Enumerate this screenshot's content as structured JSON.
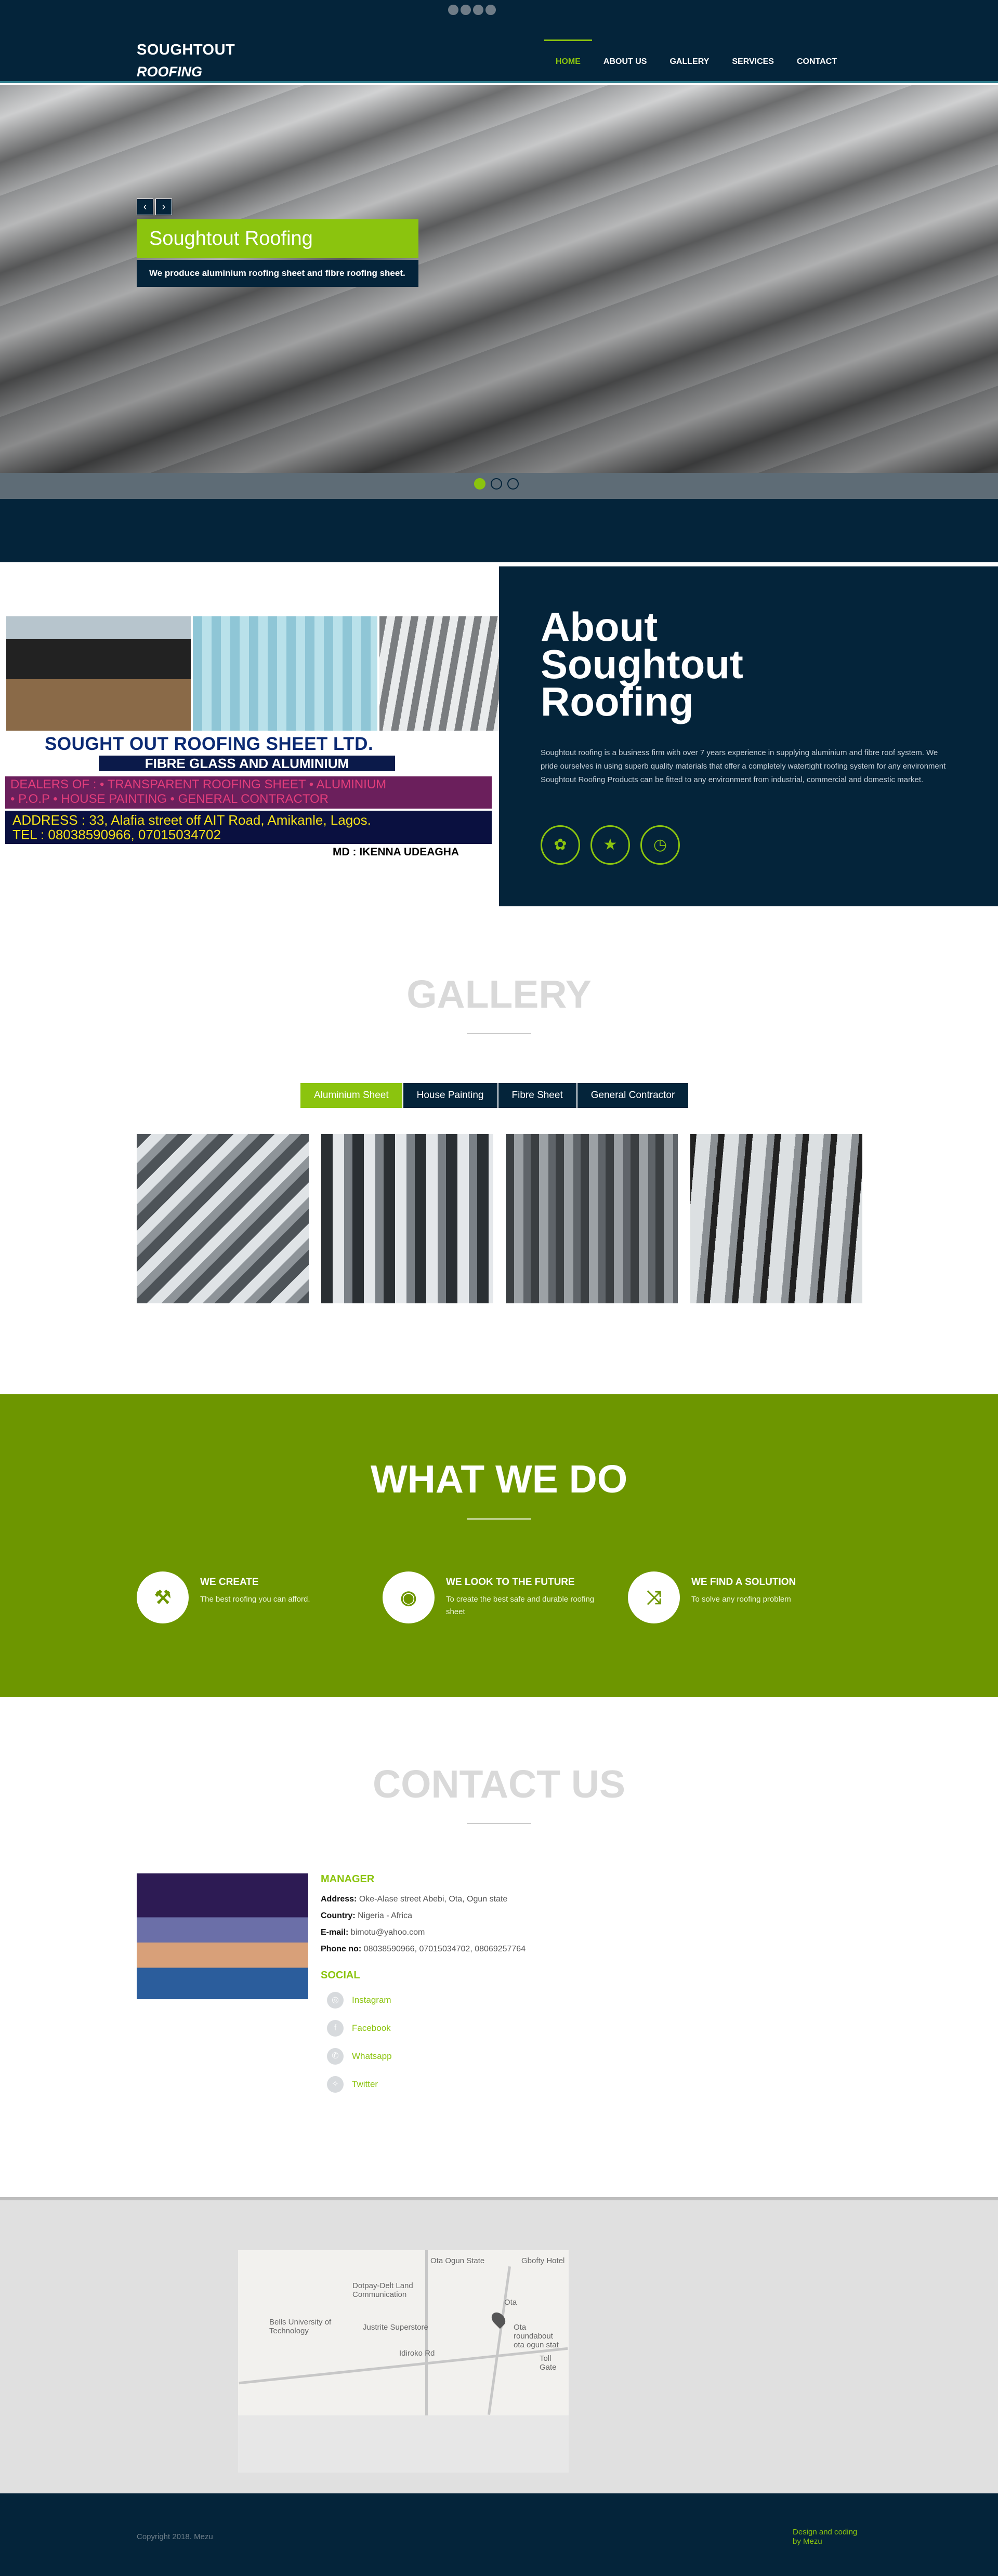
{
  "nav": {
    "brand_line1": "SOUGHTOUT",
    "brand_line2": "ROOFING",
    "items": [
      "HOME",
      "ABOUT US",
      "GALLERY",
      "SERVICES",
      "CONTACT"
    ]
  },
  "hero": {
    "prev": "‹",
    "next": "›",
    "title": "Soughtout Roofing",
    "subtitle": "We produce aluminium roofing sheet and fibre roofing sheet."
  },
  "about": {
    "heading_lines": [
      "About",
      "Soughtout",
      "Roofing"
    ],
    "text": "Soughtout roofing is a business firm with over 7 years experience in supplying aluminium and fibre roof system. We pride ourselves in using superb quality materials that offer a completely watertight roofing system for any environment Soughtout Roofing Products can be fitted to any environment from industrial, commercial and domestic market.",
    "flyer": {
      "title": "SOUGHT OUT ROOFING SHEET LTD.",
      "subtitle": "FIBRE GLASS AND ALUMINIUM",
      "dealers_line1": "DEALERS OF : • TRANSPARENT ROOFING SHEET • ALUMINIUM",
      "dealers_line2": "• P.O.P  •  HOUSE PAINTING  •  GENERAL CONTRACTOR",
      "address": "ADDRESS : 33, Alafia street off AIT Road, Amikanle, Lagos.",
      "tel": "TEL : 08038590966, 07015034702",
      "md": "MD : IKENNA UDEAGHA"
    }
  },
  "gallery": {
    "title": "GALLERY",
    "tabs": [
      "Aluminium Sheet",
      "House Painting",
      "Fibre Sheet",
      "General Contractor"
    ],
    "active_tab": 0
  },
  "what_we_do": {
    "title": "WHAT WE DO",
    "features": [
      {
        "icon": "tools-icon",
        "glyph": "⚒",
        "title": "WE CREATE",
        "text": "The best roofing you can afford."
      },
      {
        "icon": "eye-icon",
        "glyph": "◉",
        "title": "WE LOOK TO THE FUTURE",
        "text": "To create the best safe and durable roofing sheet"
      },
      {
        "icon": "shuffle-icon",
        "glyph": "⤨",
        "title": "WE FIND A SOLUTION",
        "text": "To solve any roofing problem"
      }
    ]
  },
  "contact": {
    "title": "CONTACT US",
    "manager_heading": "MANAGER",
    "address_label": "Address:",
    "address": "Oke-Alase street Abebi, Ota, Ogun state",
    "country_label": "Country:",
    "country": "Nigeria - Africa",
    "email_label": "E-mail:",
    "email": "bimotu@yahoo.com",
    "phone_label": "Phone no:",
    "phone": "08038590966, 07015034702, 08069257764",
    "social_heading": "SOCIAL",
    "social": [
      {
        "icon": "instagram-icon",
        "glyph": "◎",
        "label": "Instagram"
      },
      {
        "icon": "facebook-icon",
        "glyph": "f",
        "label": "Facebook"
      },
      {
        "icon": "whatsapp-icon",
        "glyph": "✆",
        "label": "Whatsapp"
      },
      {
        "icon": "twitter-icon",
        "glyph": "✧",
        "label": "Twitter"
      }
    ]
  },
  "map": {
    "labels": [
      "Ota Ogun State",
      "Gbofty Hotel",
      "Dotpay-Delt Land Communication",
      "Ota",
      "Bells University of Technology",
      "Justrite Superstore",
      "Ota roundabout ota ogun stat",
      "Toll Gate",
      "Idiroko Rd"
    ]
  },
  "footer": {
    "copyright": "Copyright 2018. Mezu",
    "design_line1": "Design and coding",
    "design_line2": "by Mezu"
  },
  "colors": {
    "navy": "#04243a",
    "green": "#8bc40e",
    "olive": "#6d9600"
  }
}
